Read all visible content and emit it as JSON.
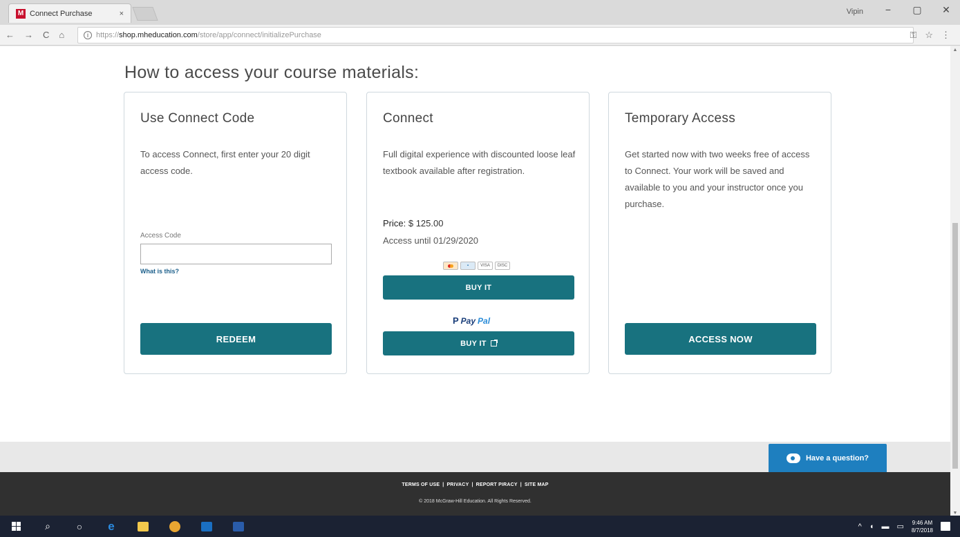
{
  "browser": {
    "tab_title": "Connect Purchase",
    "tab_close": "×",
    "favicon_letter": "M",
    "user_label": "Vipin",
    "window_controls": [
      "−",
      "▢",
      "✕"
    ],
    "nav": [
      "←",
      "→",
      "C",
      "⌂"
    ],
    "url_prefix": "https://",
    "url_domain": "shop.mheducation.com",
    "url_path": "/store/app/connect/initializePurchase",
    "addr_icons": [
      "⚿",
      "☆",
      "⋮"
    ]
  },
  "page": {
    "heading": "How to access your course materials:"
  },
  "cards": {
    "code": {
      "title": "Use Connect Code",
      "description": "To access Connect, first enter your 20 digit access code.",
      "input_label": "Access Code",
      "input_value": "",
      "help_link": "What is this?",
      "button": "REDEEM"
    },
    "connect": {
      "title": "Connect",
      "description": "Full digital experience with discounted loose leaf textbook available after registration.",
      "price_label": "Price:",
      "price_value": "$ 125.00",
      "access_until": "Access until 01/29/2020",
      "card_logos": [
        "mastercard",
        "amex",
        "visa",
        "discover"
      ],
      "buy_button": "BUY IT",
      "paypal_brand_1": "Pay",
      "paypal_brand_2": "Pal",
      "paypal_button": "BUY IT"
    },
    "temporary": {
      "title": "Temporary Access",
      "description": "Get started now with two weeks free of access to Connect. Your work will be saved and available to you and your instructor once you purchase.",
      "button": "ACCESS NOW"
    }
  },
  "help": {
    "label": "Have a question?"
  },
  "footer": {
    "links": [
      "TERMS OF USE",
      "PRIVACY",
      "REPORT PIRACY",
      "SITE MAP"
    ],
    "separator": "|",
    "copyright": "© 2018 McGraw-Hill Education. All Rights Reserved."
  },
  "taskbar": {
    "clock_time": "9:46 AM",
    "clock_date": "8/7/2018"
  },
  "colors": {
    "primary_button": "#18727f",
    "help_button": "#1e7fbf",
    "footer_bg": "#303030"
  }
}
